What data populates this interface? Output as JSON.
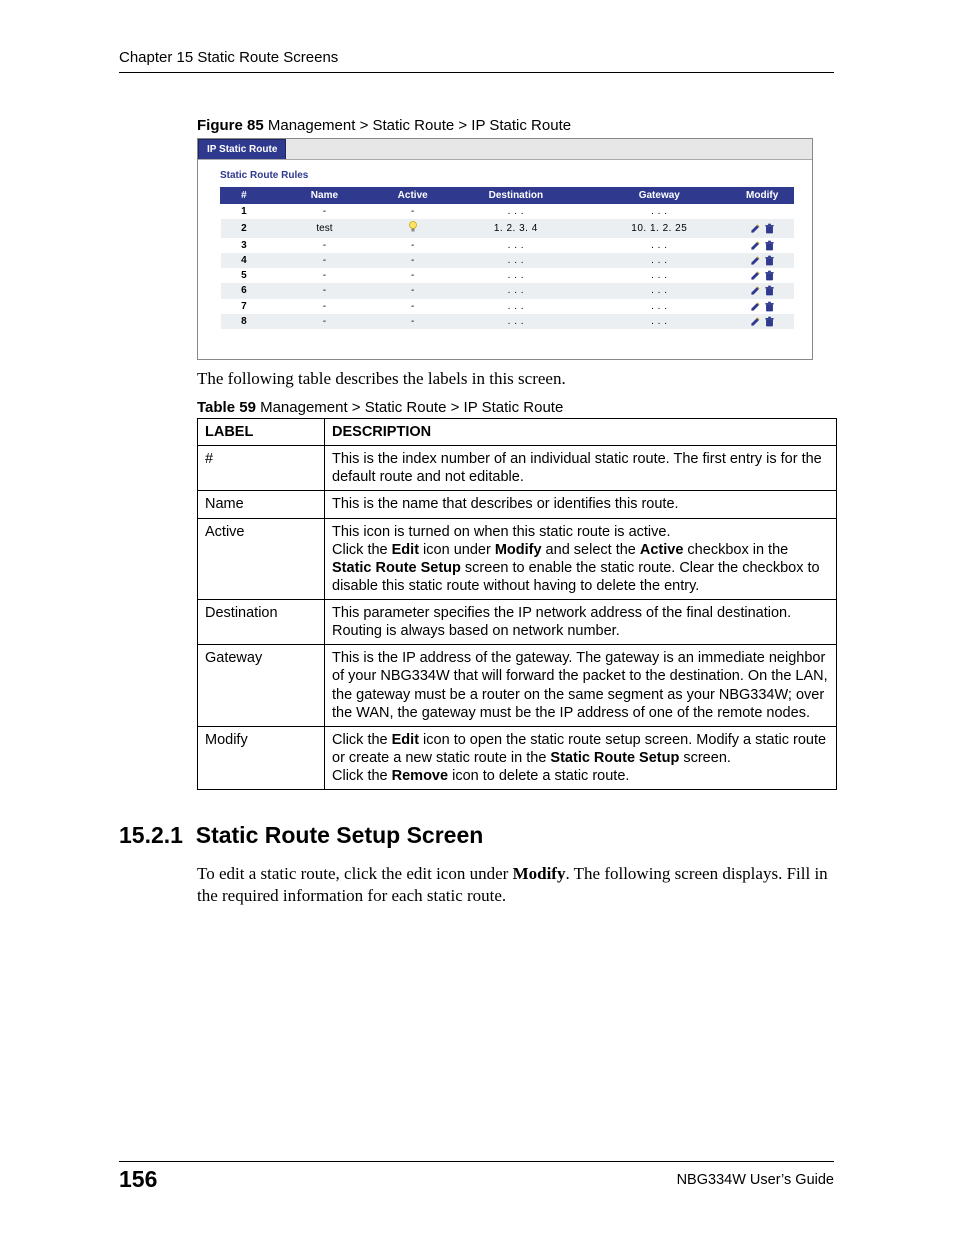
{
  "running_head": "Chapter 15 Static Route Screens",
  "figure_caption": {
    "label": "Figure 85",
    "text": "   Management > Static Route > IP Static Route"
  },
  "figure": {
    "tab": "IP Static Route",
    "panel_title": "Static Route Rules",
    "headers": [
      "#",
      "Name",
      "Active",
      "Destination",
      "Gateway",
      "Modify"
    ],
    "rows": [
      {
        "idx": "1",
        "name": "-",
        "active": "-",
        "dest": ". . .",
        "gw": ". . .",
        "edit": false,
        "del": false
      },
      {
        "idx": "2",
        "name": "test",
        "active": "bulb",
        "dest": "1. 2. 3. 4",
        "gw": "10. 1. 2. 25",
        "edit": true,
        "del": true
      },
      {
        "idx": "3",
        "name": "-",
        "active": "-",
        "dest": ". . .",
        "gw": ". . .",
        "edit": true,
        "del": true
      },
      {
        "idx": "4",
        "name": "-",
        "active": "-",
        "dest": ". . .",
        "gw": ". . .",
        "edit": true,
        "del": true
      },
      {
        "idx": "5",
        "name": "-",
        "active": "-",
        "dest": ". . .",
        "gw": ". . .",
        "edit": true,
        "del": true
      },
      {
        "idx": "6",
        "name": "-",
        "active": "-",
        "dest": ". . .",
        "gw": ". . .",
        "edit": true,
        "del": true
      },
      {
        "idx": "7",
        "name": "-",
        "active": "-",
        "dest": ". . .",
        "gw": ". . .",
        "edit": true,
        "del": true
      },
      {
        "idx": "8",
        "name": "-",
        "active": "-",
        "dest": ". . .",
        "gw": ". . .",
        "edit": true,
        "del": true
      }
    ]
  },
  "intro_line": "The following table describes the labels in this screen.",
  "table_caption": {
    "label": "Table 59",
    "text": "   Management > Static Route > IP Static Route"
  },
  "desc_headers": {
    "label": "LABEL",
    "description": "DESCRIPTION"
  },
  "desc_rows": [
    {
      "label": "#",
      "html": "This is the index number of an individual static route. The first entry is for the default route and not editable."
    },
    {
      "label": "Name",
      "html": "This is the name that describes or identifies this route."
    },
    {
      "label": "Active",
      "html": "This icon is turned on when this static route is active.<br>Click the <span class='b'>Edit</span> icon under <span class='b'>Modify</span> and select the <span class='b'>Active</span> checkbox in the <span class='b'>Static Route Setup</span> screen to enable the static route. Clear the checkbox to disable this static route without having to delete the entry."
    },
    {
      "label": "Destination",
      "html": "This parameter specifies the IP network address of the final destination. Routing is always based on network number."
    },
    {
      "label": "Gateway",
      "html": "This is the IP address of the gateway. The gateway is an immediate neighbor of your NBG334W that will forward the packet to the destination. On the LAN, the gateway must be a router on the same segment as your NBG334W; over the WAN, the gateway must be the IP address of one of the remote nodes."
    },
    {
      "label": "Modify",
      "html": "Click the <span class='b'>Edit</span> icon to open the static route setup screen. Modify a static route or create a new static route in the <span class='b'>Static Route Setup</span> screen.<br>Click the <span class='b'>Remove</span> icon to delete a static route."
    }
  ],
  "section": {
    "number": "15.2.1",
    "title": "Static Route Setup Screen",
    "para_pre": "To edit a static route, click the edit icon under ",
    "para_bold": "Modify",
    "para_post": ". The following screen displays. Fill in the required information for each static route."
  },
  "footer": {
    "page": "156",
    "guide": "NBG334W User’s Guide"
  }
}
